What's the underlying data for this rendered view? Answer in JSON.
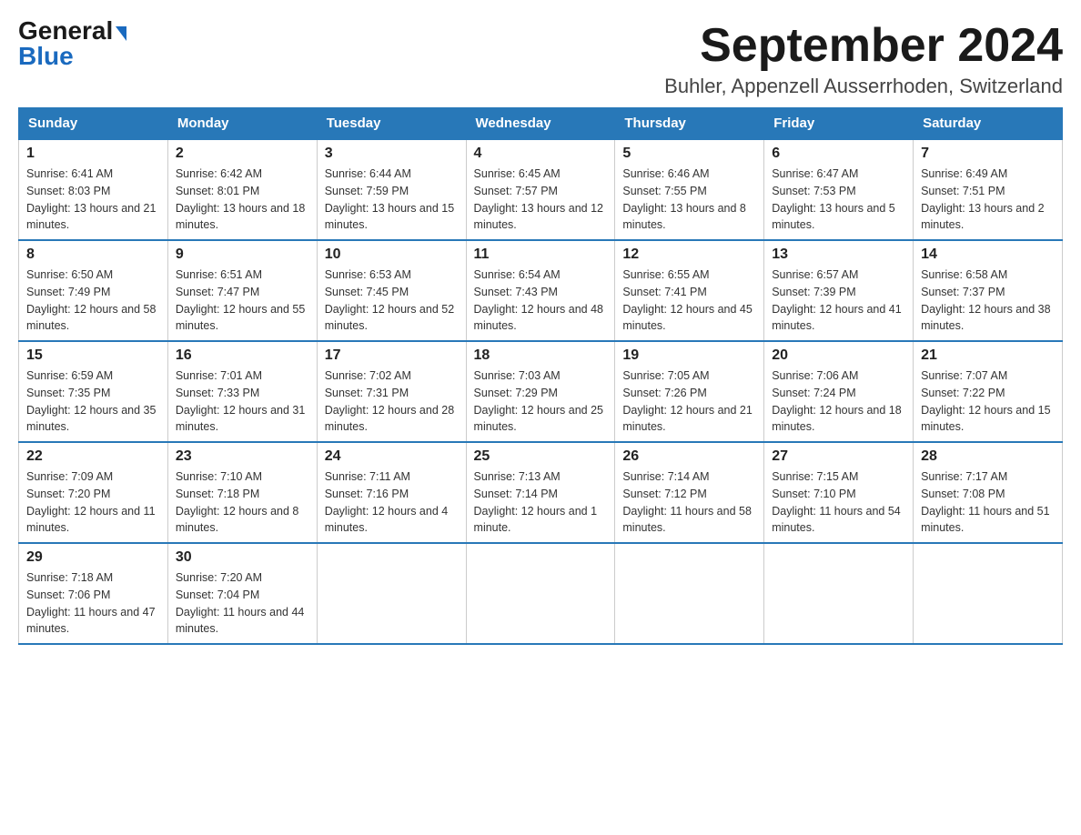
{
  "header": {
    "logo_general": "General",
    "logo_blue": "Blue",
    "month_year": "September 2024",
    "location": "Buhler, Appenzell Ausserrhoden, Switzerland"
  },
  "columns": [
    "Sunday",
    "Monday",
    "Tuesday",
    "Wednesday",
    "Thursday",
    "Friday",
    "Saturday"
  ],
  "weeks": [
    [
      {
        "day": "1",
        "sunrise": "Sunrise: 6:41 AM",
        "sunset": "Sunset: 8:03 PM",
        "daylight": "Daylight: 13 hours and 21 minutes."
      },
      {
        "day": "2",
        "sunrise": "Sunrise: 6:42 AM",
        "sunset": "Sunset: 8:01 PM",
        "daylight": "Daylight: 13 hours and 18 minutes."
      },
      {
        "day": "3",
        "sunrise": "Sunrise: 6:44 AM",
        "sunset": "Sunset: 7:59 PM",
        "daylight": "Daylight: 13 hours and 15 minutes."
      },
      {
        "day": "4",
        "sunrise": "Sunrise: 6:45 AM",
        "sunset": "Sunset: 7:57 PM",
        "daylight": "Daylight: 13 hours and 12 minutes."
      },
      {
        "day": "5",
        "sunrise": "Sunrise: 6:46 AM",
        "sunset": "Sunset: 7:55 PM",
        "daylight": "Daylight: 13 hours and 8 minutes."
      },
      {
        "day": "6",
        "sunrise": "Sunrise: 6:47 AM",
        "sunset": "Sunset: 7:53 PM",
        "daylight": "Daylight: 13 hours and 5 minutes."
      },
      {
        "day": "7",
        "sunrise": "Sunrise: 6:49 AM",
        "sunset": "Sunset: 7:51 PM",
        "daylight": "Daylight: 13 hours and 2 minutes."
      }
    ],
    [
      {
        "day": "8",
        "sunrise": "Sunrise: 6:50 AM",
        "sunset": "Sunset: 7:49 PM",
        "daylight": "Daylight: 12 hours and 58 minutes."
      },
      {
        "day": "9",
        "sunrise": "Sunrise: 6:51 AM",
        "sunset": "Sunset: 7:47 PM",
        "daylight": "Daylight: 12 hours and 55 minutes."
      },
      {
        "day": "10",
        "sunrise": "Sunrise: 6:53 AM",
        "sunset": "Sunset: 7:45 PM",
        "daylight": "Daylight: 12 hours and 52 minutes."
      },
      {
        "day": "11",
        "sunrise": "Sunrise: 6:54 AM",
        "sunset": "Sunset: 7:43 PM",
        "daylight": "Daylight: 12 hours and 48 minutes."
      },
      {
        "day": "12",
        "sunrise": "Sunrise: 6:55 AM",
        "sunset": "Sunset: 7:41 PM",
        "daylight": "Daylight: 12 hours and 45 minutes."
      },
      {
        "day": "13",
        "sunrise": "Sunrise: 6:57 AM",
        "sunset": "Sunset: 7:39 PM",
        "daylight": "Daylight: 12 hours and 41 minutes."
      },
      {
        "day": "14",
        "sunrise": "Sunrise: 6:58 AM",
        "sunset": "Sunset: 7:37 PM",
        "daylight": "Daylight: 12 hours and 38 minutes."
      }
    ],
    [
      {
        "day": "15",
        "sunrise": "Sunrise: 6:59 AM",
        "sunset": "Sunset: 7:35 PM",
        "daylight": "Daylight: 12 hours and 35 minutes."
      },
      {
        "day": "16",
        "sunrise": "Sunrise: 7:01 AM",
        "sunset": "Sunset: 7:33 PM",
        "daylight": "Daylight: 12 hours and 31 minutes."
      },
      {
        "day": "17",
        "sunrise": "Sunrise: 7:02 AM",
        "sunset": "Sunset: 7:31 PM",
        "daylight": "Daylight: 12 hours and 28 minutes."
      },
      {
        "day": "18",
        "sunrise": "Sunrise: 7:03 AM",
        "sunset": "Sunset: 7:29 PM",
        "daylight": "Daylight: 12 hours and 25 minutes."
      },
      {
        "day": "19",
        "sunrise": "Sunrise: 7:05 AM",
        "sunset": "Sunset: 7:26 PM",
        "daylight": "Daylight: 12 hours and 21 minutes."
      },
      {
        "day": "20",
        "sunrise": "Sunrise: 7:06 AM",
        "sunset": "Sunset: 7:24 PM",
        "daylight": "Daylight: 12 hours and 18 minutes."
      },
      {
        "day": "21",
        "sunrise": "Sunrise: 7:07 AM",
        "sunset": "Sunset: 7:22 PM",
        "daylight": "Daylight: 12 hours and 15 minutes."
      }
    ],
    [
      {
        "day": "22",
        "sunrise": "Sunrise: 7:09 AM",
        "sunset": "Sunset: 7:20 PM",
        "daylight": "Daylight: 12 hours and 11 minutes."
      },
      {
        "day": "23",
        "sunrise": "Sunrise: 7:10 AM",
        "sunset": "Sunset: 7:18 PM",
        "daylight": "Daylight: 12 hours and 8 minutes."
      },
      {
        "day": "24",
        "sunrise": "Sunrise: 7:11 AM",
        "sunset": "Sunset: 7:16 PM",
        "daylight": "Daylight: 12 hours and 4 minutes."
      },
      {
        "day": "25",
        "sunrise": "Sunrise: 7:13 AM",
        "sunset": "Sunset: 7:14 PM",
        "daylight": "Daylight: 12 hours and 1 minute."
      },
      {
        "day": "26",
        "sunrise": "Sunrise: 7:14 AM",
        "sunset": "Sunset: 7:12 PM",
        "daylight": "Daylight: 11 hours and 58 minutes."
      },
      {
        "day": "27",
        "sunrise": "Sunrise: 7:15 AM",
        "sunset": "Sunset: 7:10 PM",
        "daylight": "Daylight: 11 hours and 54 minutes."
      },
      {
        "day": "28",
        "sunrise": "Sunrise: 7:17 AM",
        "sunset": "Sunset: 7:08 PM",
        "daylight": "Daylight: 11 hours and 51 minutes."
      }
    ],
    [
      {
        "day": "29",
        "sunrise": "Sunrise: 7:18 AM",
        "sunset": "Sunset: 7:06 PM",
        "daylight": "Daylight: 11 hours and 47 minutes."
      },
      {
        "day": "30",
        "sunrise": "Sunrise: 7:20 AM",
        "sunset": "Sunset: 7:04 PM",
        "daylight": "Daylight: 11 hours and 44 minutes."
      },
      null,
      null,
      null,
      null,
      null
    ]
  ]
}
